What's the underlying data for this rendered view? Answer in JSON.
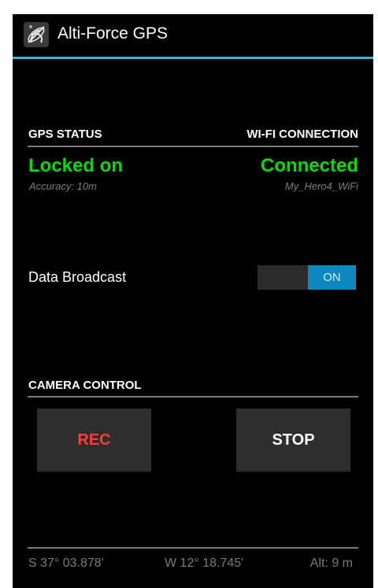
{
  "app": {
    "title": "Alti-Force GPS",
    "icon": "satellite-icon",
    "accent_color": "#33b5e5"
  },
  "gps": {
    "header": "GPS STATUS",
    "status": "Locked on",
    "accuracy": "Accuracy: 10m",
    "status_color": "#00e000"
  },
  "wifi": {
    "header": "WI-FI CONNECTION",
    "status": "Connected",
    "ssid": "My_Hero4_WiFi",
    "status_color": "#00e000"
  },
  "broadcast": {
    "label": "Data Broadcast",
    "toggle_text": "ON",
    "toggle_on": true
  },
  "camera": {
    "header": "CAMERA CONTROL",
    "rec_label": "REC",
    "stop_label": "STOP",
    "rec_color": "#ff3b3b"
  },
  "footer": {
    "latitude": "S 37° 03.878'",
    "longitude": "W 12° 18.745'",
    "altitude": "Alt: 9 m"
  }
}
